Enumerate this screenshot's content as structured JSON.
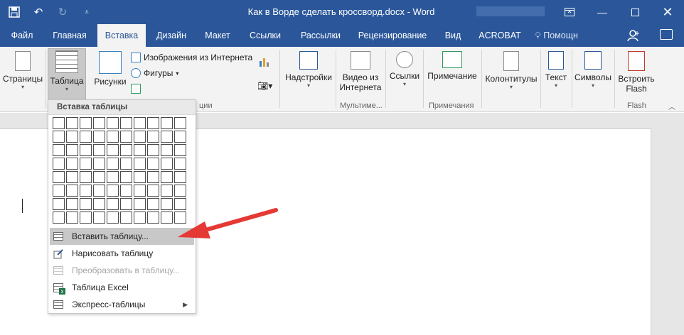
{
  "window": {
    "title": "Как в Ворде сделать кроссворд.docx - Word",
    "quick_access": [
      "save-icon",
      "undo-icon",
      "redo-icon",
      "customize-icon"
    ],
    "controls": [
      "ribbon-display-icon",
      "minimize-icon",
      "maximize-icon",
      "close-icon"
    ]
  },
  "tabs": [
    {
      "label": "Файл"
    },
    {
      "label": "Главная"
    },
    {
      "label": "Вставка",
      "active": true
    },
    {
      "label": "Дизайн"
    },
    {
      "label": "Макет"
    },
    {
      "label": "Ссылки"
    },
    {
      "label": "Рассылки"
    },
    {
      "label": "Рецензирование"
    },
    {
      "label": "Вид"
    },
    {
      "label": "ACROBAT"
    }
  ],
  "tell_me": "Помощн",
  "ribbon": {
    "pages": "Страницы",
    "table": "Таблица",
    "pictures": "Рисунки",
    "online_images": "Изображения из Интернета",
    "shapes": "Фигуры",
    "illustrations_group_partial": "ции",
    "addins": "Надстройки",
    "video_line1": "Видео из",
    "video_line2": "Интернета",
    "media_group": "Мультиме...",
    "links": "Ссылки",
    "comment": "Примечание",
    "comments_group": "Примечания",
    "header_footer": "Колонтитулы",
    "text": "Текст",
    "symbols": "Символы",
    "flash_line1": "Встроить",
    "flash_line2": "Flash",
    "flash_group": "Flash"
  },
  "dropdown": {
    "header": "Вставка таблицы",
    "grid_cols": 10,
    "grid_rows": 8,
    "items": [
      {
        "label": "Вставить таблицу...",
        "highlighted": true
      },
      {
        "label": "Нарисовать таблицу"
      },
      {
        "label": "Преобразовать в таблицу...",
        "disabled": true
      },
      {
        "label": "Таблица Excel"
      },
      {
        "label": "Экспресс-таблицы",
        "submenu": true
      }
    ]
  },
  "colors": {
    "titlebar": "#2b579a",
    "ribbon": "#f3f3f3",
    "annotation_arrow": "#e53935"
  }
}
